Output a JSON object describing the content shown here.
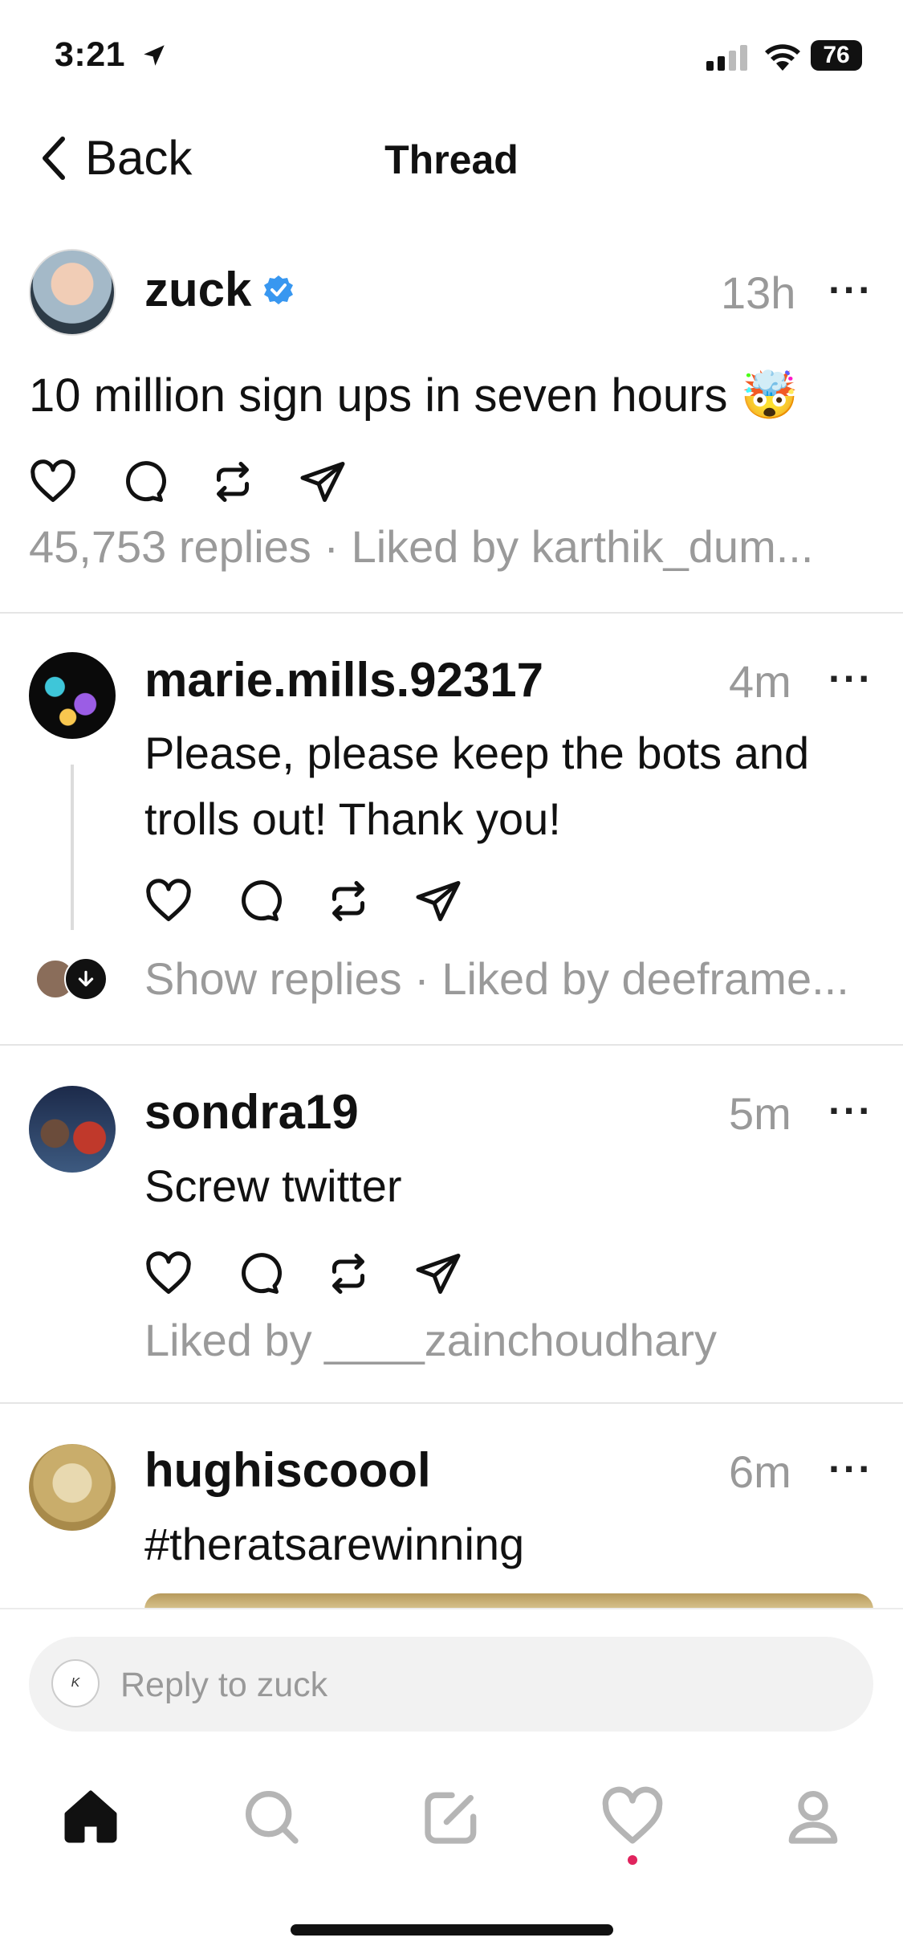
{
  "status_bar": {
    "time": "3:21",
    "battery": "76"
  },
  "nav": {
    "back_label": "Back",
    "title": "Thread"
  },
  "main_post": {
    "username": "zuck",
    "time": "13h",
    "more": "···",
    "text": "10 million sign ups in seven hours 🤯",
    "meta": "45,753 replies · Liked by karthik_dum..."
  },
  "replies": [
    {
      "username": "marie.mills.92317",
      "time": "4m",
      "more": "···",
      "text": "Please, please keep the bots and trolls out! Thank you!",
      "meta": "Show replies · Liked by deeframe..."
    },
    {
      "username": "sondra19",
      "time": "5m",
      "more": "···",
      "text": "Screw twitter",
      "meta": "Liked by ____zainchoudhary"
    },
    {
      "username": "hughiscoool",
      "time": "6m",
      "more": "···",
      "text": "#theratsarewinning"
    }
  ],
  "reply_bar": {
    "placeholder": "Reply to zuck"
  },
  "tab_bar": {
    "items": [
      "home-icon",
      "search-icon",
      "compose-icon",
      "heart-icon",
      "profile-icon"
    ],
    "notification_color": "#e0245e"
  },
  "colors": {
    "verified": "#3897f0",
    "muted": "#999999"
  }
}
